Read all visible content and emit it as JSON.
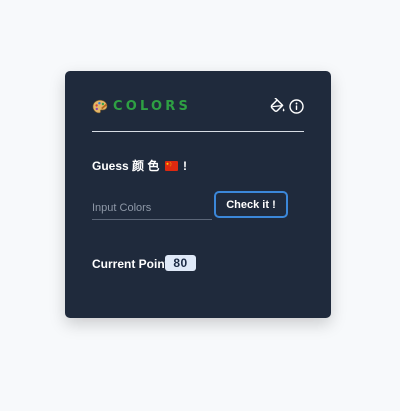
{
  "app": {
    "title": "COLORS"
  },
  "prompt": {
    "prefix": "Guess 颜 色",
    "suffix": "!"
  },
  "input": {
    "placeholder": "Input Colors",
    "value": ""
  },
  "button": {
    "label": "Check it !"
  },
  "score": {
    "label": "Current Point:",
    "value": "80"
  },
  "icons": {
    "logo": "palette-icon",
    "bucket": "paint-bucket-icon",
    "info": "info-icon",
    "flag": "flag-icon"
  },
  "colors": {
    "card_bg": "#1f2a3c",
    "title": "#2ea043",
    "button_border": "#3b87d9",
    "badge_bg": "#dfe9f8"
  }
}
